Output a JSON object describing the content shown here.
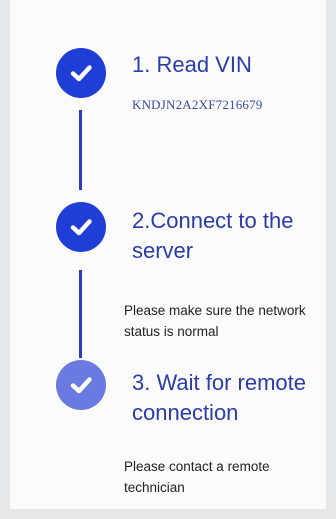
{
  "steps": [
    {
      "title": "1. Read VIN",
      "detail": "KNDJN2A2XF7216679",
      "status": "done",
      "icon": "check-circle-icon",
      "color": "#1f3ed6"
    },
    {
      "title": "2.Connect to the server",
      "detail": "Please make sure the network status is normal",
      "status": "done",
      "icon": "check-circle-icon",
      "color": "#1f3ed6"
    },
    {
      "title": "3. Wait for remote connection",
      "detail": "Please contact a remote technician",
      "status": "in-progress",
      "icon": "check-circle-icon",
      "color": "#6a7ae0"
    }
  ],
  "connector_color": "#2b3cbf"
}
